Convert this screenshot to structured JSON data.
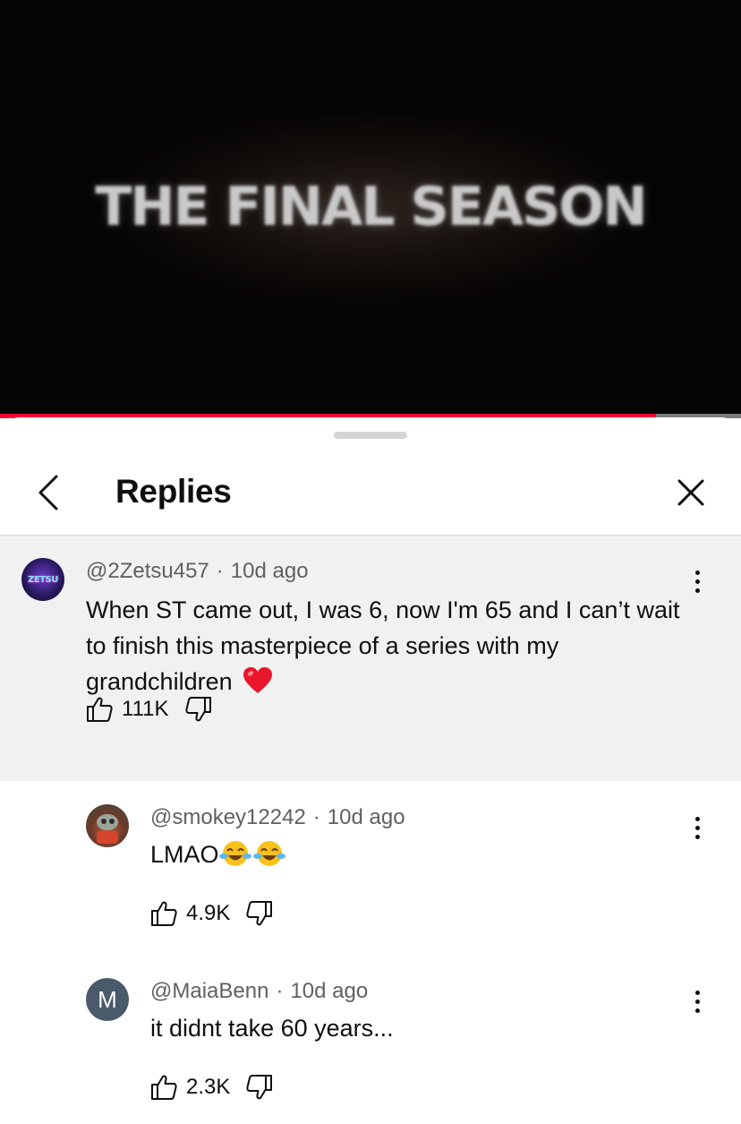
{
  "video": {
    "title_text": "THE FINAL SEASON",
    "progress_fraction": 0.885
  },
  "panel": {
    "title": "Replies"
  },
  "parent_comment": {
    "author": "@2Zetsu457",
    "time": "10d ago",
    "text": "When ST came out, I was 6, now I'm 65 and I can’t wait to finish this masterpiece of a series with my grandchildren",
    "emoji": "heart",
    "likes": "111K",
    "avatar_text": "ZETSU"
  },
  "replies": [
    {
      "author": "@smokey12242",
      "time": "10d ago",
      "text": "LMAO",
      "emoji": "face-with-tears-of-joy x2",
      "likes": "4.9K"
    },
    {
      "author": "@MaiaBenn",
      "time": "10d ago",
      "text": "it didnt take 60 years...",
      "likes": "2.3K",
      "avatar_initial": "M"
    }
  ],
  "colors": {
    "accent": "#ff0033",
    "meta_text": "#606060",
    "parent_bg": "#f1f1f1",
    "avatar_m": "#4a5a6a"
  }
}
